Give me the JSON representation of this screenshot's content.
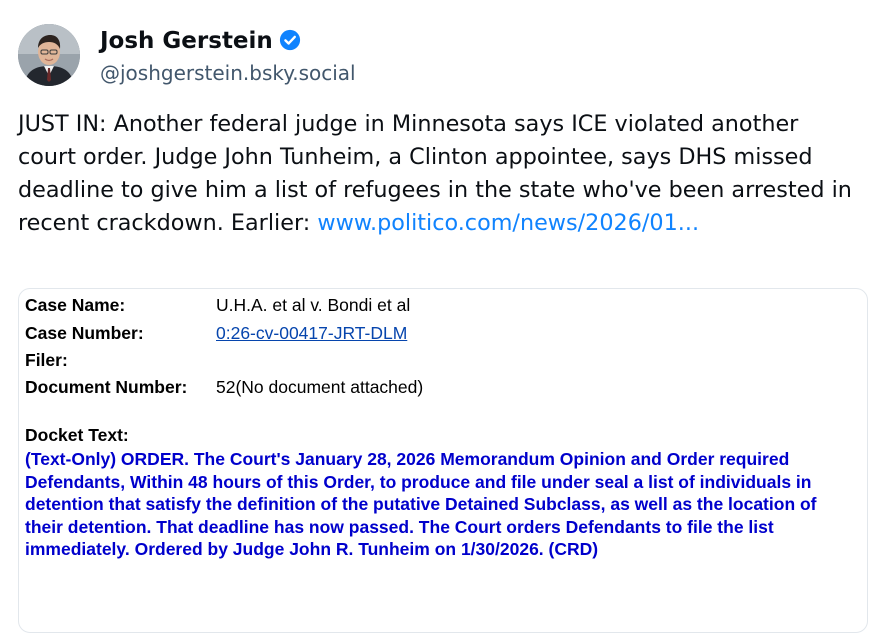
{
  "post": {
    "author": {
      "name": "Josh Gerstein",
      "handle": "@joshgerstein.bsky.social",
      "verified_color": "#1083fe"
    },
    "text": "JUST IN: Another federal judge in Minnesota says ICE violated another court order. Judge John Tunheim, a Clinton appointee, says DHS missed deadline to give him a list of refugees in the state who've been arrested in recent crackdown. Earlier: ",
    "link_text": "www.politico.com/news/2026/01..."
  },
  "embed": {
    "case_name_label": "Case Name:",
    "case_name": "U.H.A. et al v. Bondi et al",
    "case_number_label": "Case Number:",
    "case_number": "0:26-cv-00417-JRT-DLM",
    "filer_label": "Filer:",
    "document_number_label": "Document Number:",
    "document_number": "52(No document attached)",
    "docket_text_label": "Docket Text:",
    "docket_text": "(Text-Only) ORDER. The Court's January 28, 2026 Memorandum Opinion and Order required Defendants, Within 48 hours of this Order, to produce and file under seal a list of individuals in detention that satisfy the definition of the putative Detained Subclass, as well as the location of their detention. That deadline has now passed. The Court orders Defendants to file the list immediately. Ordered by Judge John R. Tunheim on 1/30/2026. (CRD)",
    "docket_text_color": "#0000cc"
  },
  "icons": {
    "verified": "verified-badge-icon",
    "avatar": "avatar-photo"
  }
}
